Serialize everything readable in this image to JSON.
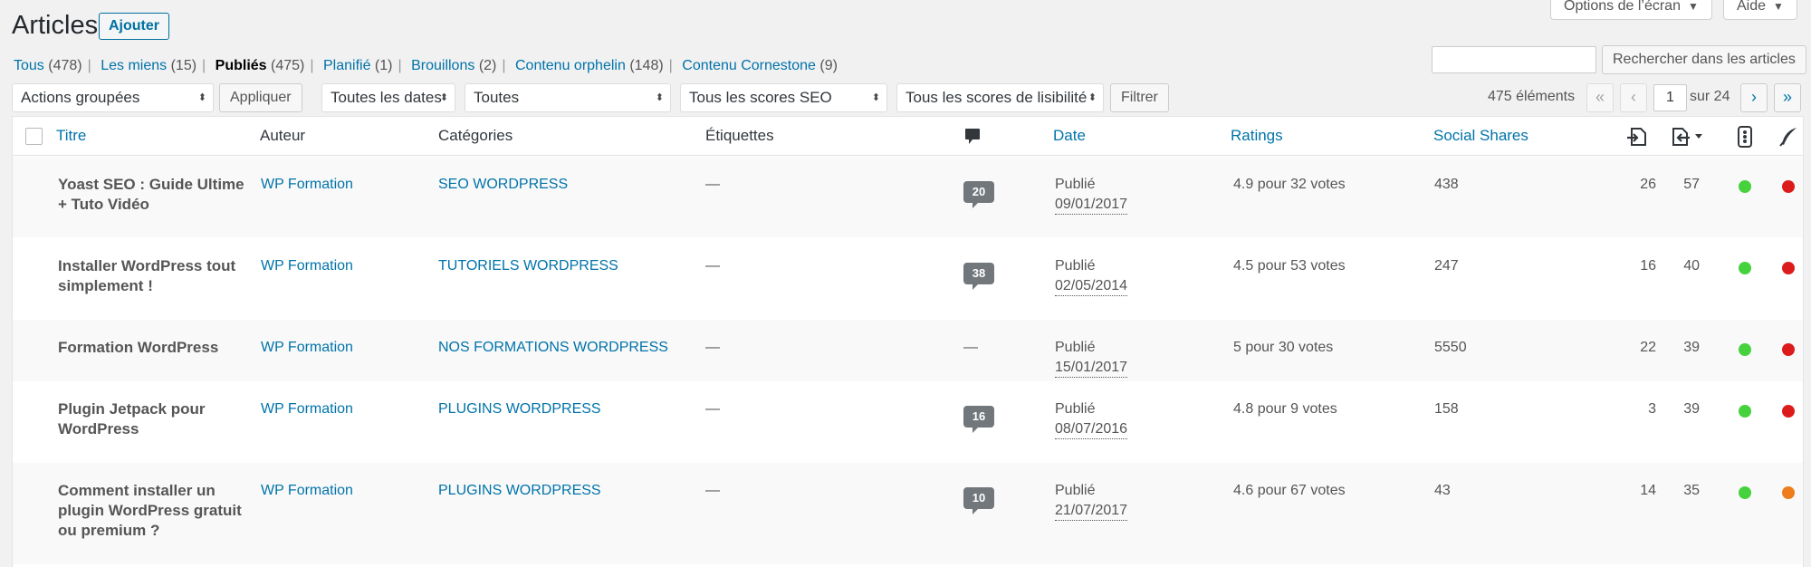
{
  "header": {
    "title": "Articles",
    "add_label": "Ajouter",
    "screen_options_label": "Options de l’écran",
    "help_label": "Aide"
  },
  "views": [
    {
      "label": "Tous",
      "count": "(478)",
      "current": false
    },
    {
      "label": "Les miens",
      "count": "(15)",
      "current": false
    },
    {
      "label": "Publiés",
      "count": "(475)",
      "current": true
    },
    {
      "label": "Planifié",
      "count": "(1)",
      "current": false
    },
    {
      "label": "Brouillons",
      "count": "(2)",
      "current": false
    },
    {
      "label": "Contenu orphelin",
      "count": "(148)",
      "current": false
    },
    {
      "label": "Contenu Cornestone",
      "count": "(9)",
      "current": false
    }
  ],
  "search": {
    "value": "",
    "button_label": "Rechercher dans les articles"
  },
  "filters": {
    "bulk_actions": "Actions groupées",
    "apply_label": "Appliquer",
    "dates": "Toutes les dates",
    "categories": "Toutes",
    "seo_scores": "Tous les scores SEO",
    "readability_scores": "Tous les scores de lisibilité",
    "filter_label": "Filtrer"
  },
  "pagination": {
    "items_count": "475 éléments",
    "first": "«",
    "prev": "‹",
    "current_page": "1",
    "of_label": "sur 24",
    "next": "›",
    "last": "»"
  },
  "columns": {
    "title": "Titre",
    "author": "Auteur",
    "categories": "Catégories",
    "tags": "Étiquettes",
    "comments_icon": "comment-icon",
    "date": "Date",
    "ratings": "Ratings",
    "social_shares": "Social Shares",
    "links_out_icon": "internal-links-out-icon",
    "links_in_icon": "internal-links-in-icon",
    "seo_icon": "seo-score-icon",
    "readability_icon": "readability-icon"
  },
  "colors": {
    "green": "#46d23c",
    "red": "#dc1c1c",
    "orange": "#ee7c1b",
    "link": "#0073aa"
  },
  "rows": [
    {
      "title_line1": "Yoast SEO : Guide Ultime",
      "title_line2": "+ Tuto Vidéo",
      "title_line3": "",
      "author": "WP Formation",
      "category": "SEO WORDPRESS",
      "tags": "—",
      "comments": "20",
      "status": "Publié",
      "date": "09/01/2017",
      "rating": "4.9 pour 32 votes",
      "shares": "438",
      "links_out": "26",
      "links_in": "57",
      "seo": "green",
      "readability": "red"
    },
    {
      "title_line1": "Installer WordPress tout",
      "title_line2": "simplement !",
      "title_line3": "",
      "author": "WP Formation",
      "category": "TUTORIELS WORDPRESS",
      "tags": "—",
      "comments": "38",
      "status": "Publié",
      "date": "02/05/2014",
      "rating": "4.5 pour 53 votes",
      "shares": "247",
      "links_out": "16",
      "links_in": "40",
      "seo": "green",
      "readability": "red"
    },
    {
      "title_line1": "Formation WordPress",
      "title_line2": "",
      "title_line3": "",
      "author": "WP Formation",
      "category": "NOS FORMATIONS WORDPRESS",
      "tags": "—",
      "comments": "—",
      "status": "Publié",
      "date": "15/01/2017",
      "rating": "5 pour 30 votes",
      "shares": "5550",
      "links_out": "22",
      "links_in": "39",
      "seo": "green",
      "readability": "red"
    },
    {
      "title_line1": "Plugin Jetpack pour",
      "title_line2": "WordPress",
      "title_line3": "",
      "author": "WP Formation",
      "category": "PLUGINS WORDPRESS",
      "tags": "—",
      "comments": "16",
      "status": "Publié",
      "date": "08/07/2016",
      "rating": "4.8 pour 9 votes",
      "shares": "158",
      "links_out": "3",
      "links_in": "39",
      "seo": "green",
      "readability": "red"
    },
    {
      "title_line1": "Comment installer un",
      "title_line2": "plugin WordPress gratuit",
      "title_line3": "ou premium ?",
      "author": "WP Formation",
      "category": "PLUGINS WORDPRESS",
      "tags": "—",
      "comments": "10",
      "status": "Publié",
      "date": "21/07/2017",
      "rating": "4.6 pour 67 votes",
      "shares": "43",
      "links_out": "14",
      "links_in": "35",
      "seo": "green",
      "readability": "orange"
    }
  ]
}
